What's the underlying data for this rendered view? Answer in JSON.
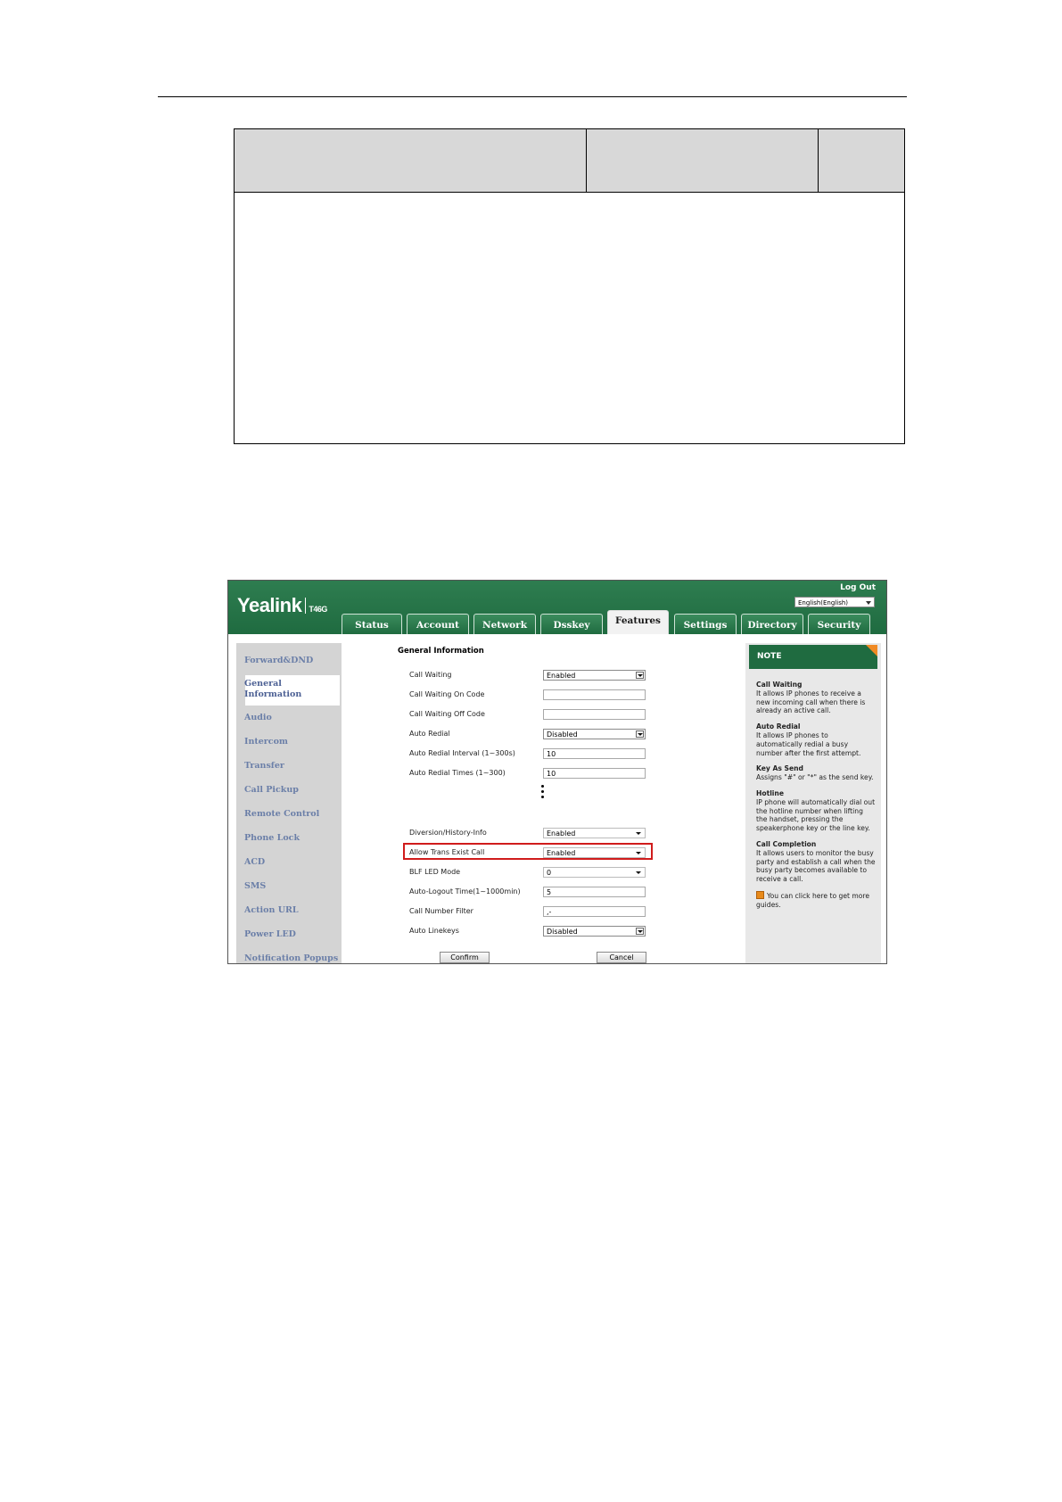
{
  "screenshot": {
    "brand": "Yealink",
    "model": "T46G",
    "logout": "Log Out",
    "language": "English(English)",
    "tabs": [
      "Status",
      "Account",
      "Network",
      "Dsskey",
      "Features",
      "Settings",
      "Directory",
      "Security"
    ],
    "active_tab": "Features",
    "sidebar": [
      "Forward&DND",
      "Audio",
      "Intercom",
      "Transfer",
      "Call Pickup",
      "Remote Control",
      "Phone Lock",
      "ACD",
      "SMS",
      "Action URL",
      "Power LED",
      "Notification Popups"
    ],
    "sidebar_active": "General Information",
    "section_title": "General Information",
    "fields": [
      {
        "label": "Call Waiting",
        "value": "Enabled"
      },
      {
        "label": "Call Waiting On Code",
        "value": ""
      },
      {
        "label": "Call Waiting Off Code",
        "value": ""
      },
      {
        "label": "Auto Redial",
        "value": "Disabled"
      },
      {
        "label": "Auto Redial Interval (1~300s)",
        "value": "10"
      },
      {
        "label": "Auto Redial Times (1~300)",
        "value": "10"
      }
    ],
    "fields2": [
      {
        "label": "Diversion/History-Info",
        "value": "Enabled"
      },
      {
        "label": "Allow Trans Exist Call",
        "value": "Enabled"
      },
      {
        "label": "BLF LED Mode",
        "value": "0"
      },
      {
        "label": "Auto-Logout Time(1~1000min)",
        "value": "5"
      },
      {
        "label": "Call Number Filter",
        "value": ",-"
      },
      {
        "label": "Auto Linekeys",
        "value": "Disabled"
      }
    ],
    "buttons": {
      "confirm": "Confirm",
      "cancel": "Cancel"
    },
    "note": {
      "title": "NOTE",
      "items": [
        {
          "heading": "Call Waiting",
          "text": "It allows IP phones to receive a new incoming call when there is already an active call."
        },
        {
          "heading": "Auto Redial",
          "text": "It allows IP phones to automatically redial a busy number after the first attempt."
        },
        {
          "heading": "Key As Send",
          "text": "Assigns \"#\" or \"*\" as the send key."
        },
        {
          "heading": "Hotline",
          "text": "IP phone will automatically dial out the hotline number when lifting the handset, pressing the speakerphone key or the line key."
        },
        {
          "heading": "Call Completion",
          "text": "It allows users to monitor the busy party and establish a call when the busy party becomes available to receive a call."
        }
      ],
      "guide": "You can click here to get more guides."
    }
  }
}
